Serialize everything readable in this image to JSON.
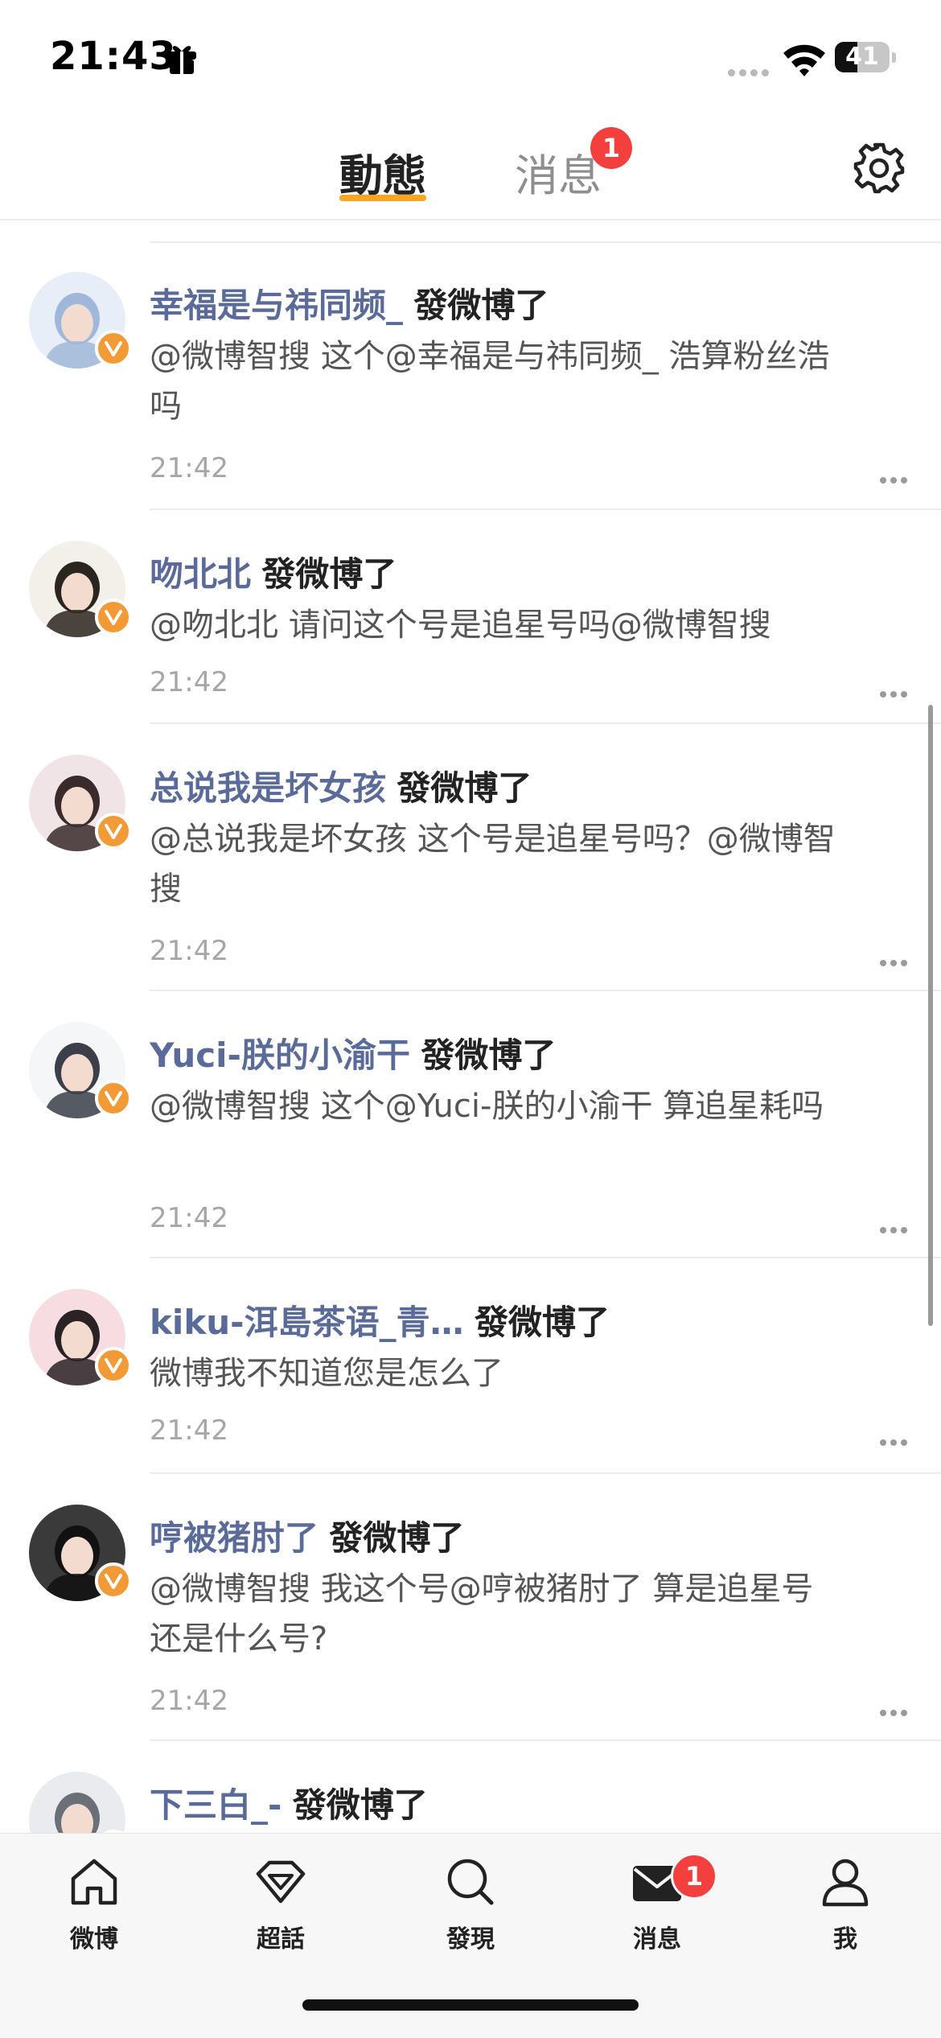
{
  "status_bar": {
    "time": "21:43",
    "battery_level": "41",
    "battery_fraction": 0.41
  },
  "header": {
    "tab_active": "動態",
    "tab_inactive": "消息",
    "tab_badge": "1"
  },
  "feed": [
    {
      "username": "幸福是与祎同频_",
      "action": "發微博了",
      "content": "@微博智搜 这个@幸福是与祎同频_ 浩算粉丝浩吗",
      "time": "21:42",
      "avatar_colors": [
        "#e7eef8",
        "#9fb7d8"
      ]
    },
    {
      "username": "吻北北",
      "action": "發微博了",
      "content": "@吻北北 请问这个号是追星号吗@微博智搜",
      "time": "21:42",
      "avatar_colors": [
        "#f3efe9",
        "#2b2520"
      ]
    },
    {
      "username": "总说我是坏女孩",
      "action": "發微博了",
      "content": "@总说我是坏女孩 这个号是追星号吗？@微博智搜",
      "time": "21:42",
      "avatar_colors": [
        "#f1e4e6",
        "#3a2a2c"
      ]
    },
    {
      "username": "Yuci-朕的小渝干",
      "action": "發微博了",
      "content": "@微博智搜 这个@Yuci-朕的小渝干 算追星耗吗",
      "time": "21:42",
      "avatar_colors": [
        "#f4f6f8",
        "#3a3f49"
      ]
    },
    {
      "username": "kiku-洱島茶语_青…",
      "action": "發微博了",
      "content": "微博我不知道您是怎么了",
      "time": "21:42",
      "avatar_colors": [
        "#f7dde2",
        "#2a2326"
      ]
    },
    {
      "username": "哼被猪肘了",
      "action": "發微博了",
      "content": "@微博智搜 我这个号@哼被猪肘了 算是追星号还是什么号?",
      "time": "21:42",
      "avatar_colors": [
        "#3a3a3a",
        "#111111"
      ]
    },
    {
      "username": "下三白_-",
      "action": "發微博了",
      "content": "",
      "time": "",
      "avatar_colors": [
        "#e9ebef",
        "#6b6f78"
      ]
    }
  ],
  "bottom_nav": {
    "items": [
      {
        "label": "微博",
        "icon": "home-icon"
      },
      {
        "label": "超話",
        "icon": "diamond-icon"
      },
      {
        "label": "發現",
        "icon": "search-icon"
      },
      {
        "label": "消息",
        "icon": "mail-icon",
        "badge": "1"
      },
      {
        "label": "我",
        "icon": "profile-icon"
      }
    ]
  },
  "colors": {
    "accent": "#f6a623",
    "badge": "#f43f3f",
    "username": "#5b6b99",
    "verified": "#f29a36"
  }
}
